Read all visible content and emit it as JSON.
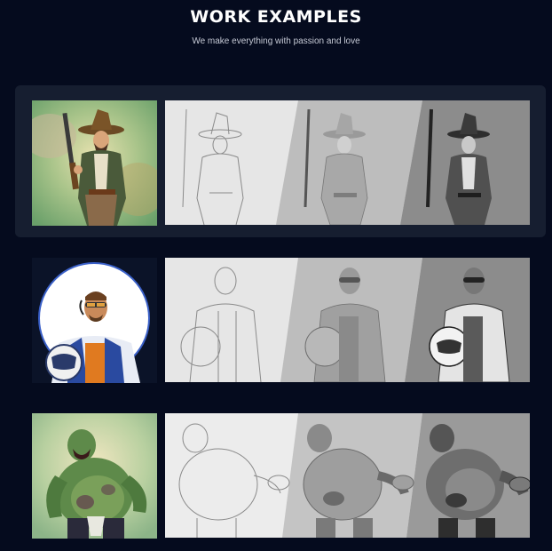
{
  "header": {
    "title": "WORK EXAMPLES",
    "subtitle": "We make everything with passion and love"
  },
  "examples": [
    {
      "id": "cowboy",
      "thumb_icon": "cowboy-illustration-icon",
      "strip_icon": "cowboy-process-stages-icon"
    },
    {
      "id": "pilot",
      "thumb_icon": "pilot-illustration-icon",
      "strip_icon": "pilot-process-stages-icon"
    },
    {
      "id": "ogre",
      "thumb_icon": "ogre-illustration-icon",
      "strip_icon": "ogre-process-stages-icon"
    }
  ],
  "colors": {
    "background": "#050b1e",
    "panel": "#161e30",
    "title": "#ffffff",
    "subtitle": "#c6cad6"
  }
}
